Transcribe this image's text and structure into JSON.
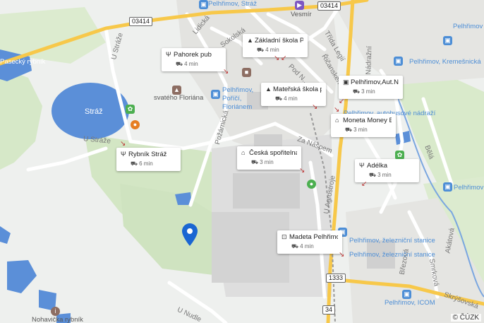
{
  "map": {
    "road_shields": [
      "03414",
      "03414",
      "1333",
      "34"
    ],
    "street_labels": [
      "U Stráže",
      "Lidická",
      "Sokolská",
      "Pod N...",
      "Požárnická",
      "Za Náspem",
      "U Agrostroje",
      "Nádražní",
      "Řičanského",
      "Třída Legií",
      "U Stráže",
      "U Nudle",
      "Březová",
      "Smrková",
      "Akátová",
      "Skrýšovská",
      "Bělá",
      "Vesmír"
    ],
    "place_labels": [
      "Stráž",
      "svatého Floriána",
      "Nohavička rybník",
      "Pasecký rybník"
    ],
    "bus_stops": [
      "Pelhřimov, Stráž",
      "Pelhřimov, Poříčí, Floriánem",
      "Pelhřimov, Kremešnická",
      "Pelhřimov, autobusové nádraží",
      "Pelhřimov, železniční stanice",
      "Pelhřimov, železniční stanice",
      "Pelhřimov, ICOM",
      "Pelhřimov",
      "Pelhřimov"
    ],
    "cards": [
      {
        "icon": "restaurant-icon",
        "title": "Pahorek pub",
        "time": "4 min"
      },
      {
        "icon": "school-icon",
        "title": "Základní škola Pe...",
        "time": "4 min"
      },
      {
        "icon": "school-icon",
        "title": "Mateřská škola p...",
        "time": "4 min"
      },
      {
        "icon": "bus-icon",
        "title": "Pelhřimov,Aut.Ná...",
        "time": "3 min"
      },
      {
        "icon": "bank-icon",
        "title": "Moneta Money B...",
        "time": "3 min"
      },
      {
        "icon": "restaurant-icon",
        "title": "Rybník Stráž",
        "time": "6 min"
      },
      {
        "icon": "bank-icon",
        "title": "Česká spořitelna",
        "time": "3 min"
      },
      {
        "icon": "restaurant-icon",
        "title": "Adélka",
        "time": "3 min"
      },
      {
        "icon": "shop-icon",
        "title": "Madeta Pelhřimov",
        "time": "4 min"
      }
    ],
    "copyright": "© ČÚZK",
    "colors": {
      "water": "#5b8fd8",
      "road_major": "#f7c84a",
      "park": "#d3e6c4",
      "pin": "#1a66d2",
      "bus": "#4d8ed6"
    }
  }
}
